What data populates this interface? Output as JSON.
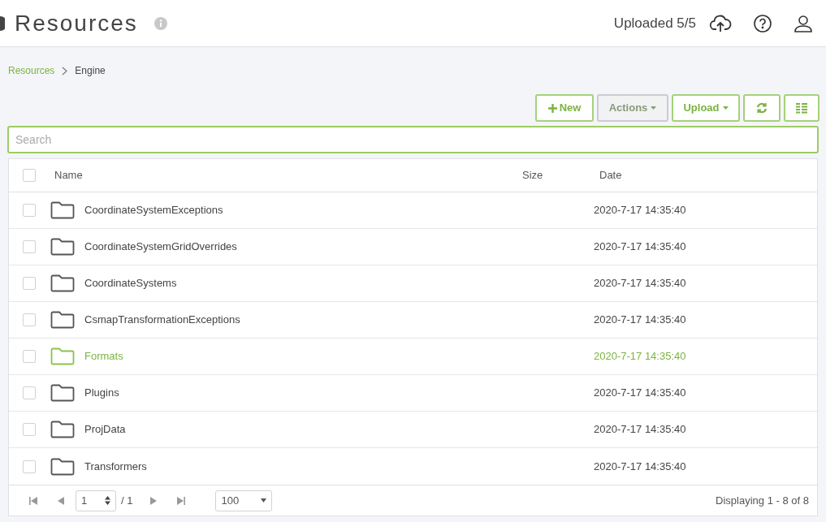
{
  "header": {
    "title": "Resources",
    "upload_status": "Uploaded 5/5"
  },
  "breadcrumb": [
    "Resources",
    "Engine"
  ],
  "toolbar": {
    "buttons": [
      {
        "kind": "new",
        "label": "New"
      },
      {
        "kind": "dropdown",
        "label": "Actions",
        "disabled": true
      },
      {
        "kind": "dropdown",
        "label": "Upload",
        "disabled": false
      },
      {
        "kind": "refresh"
      },
      {
        "kind": "view"
      }
    ]
  },
  "search": {
    "placeholder": "Search"
  },
  "table": {
    "select_all": false,
    "columns": [
      "Name",
      "Size",
      "Date"
    ],
    "rows": [
      {
        "name": "CoordinateSystemExceptions",
        "date": "2020-7-17 14:35:40",
        "hovered": false,
        "checked": false
      },
      {
        "name": "CoordinateSystemGridOverrides",
        "date": "2020-7-17 14:35:40",
        "hovered": false,
        "checked": false
      },
      {
        "name": "CoordinateSystems",
        "date": "2020-7-17 14:35:40",
        "hovered": false,
        "checked": false
      },
      {
        "name": "CsmapTransformationExceptions",
        "date": "2020-7-17 14:35:40",
        "hovered": false,
        "checked": false
      },
      {
        "name": "Formats",
        "date": "2020-7-17 14:35:40",
        "hovered": true,
        "checked": false
      },
      {
        "name": "Plugins",
        "date": "2020-7-17 14:35:40",
        "hovered": false,
        "checked": false
      },
      {
        "name": "ProjData",
        "date": "2020-7-17 14:35:40",
        "hovered": false,
        "checked": false
      },
      {
        "name": "Transformers",
        "date": "2020-7-17 14:35:40",
        "hovered": false,
        "checked": false
      }
    ]
  },
  "pager": {
    "page": "1",
    "of": "/ 1",
    "page_size": "100",
    "summary": "Displaying 1 - 8 of 8"
  }
}
